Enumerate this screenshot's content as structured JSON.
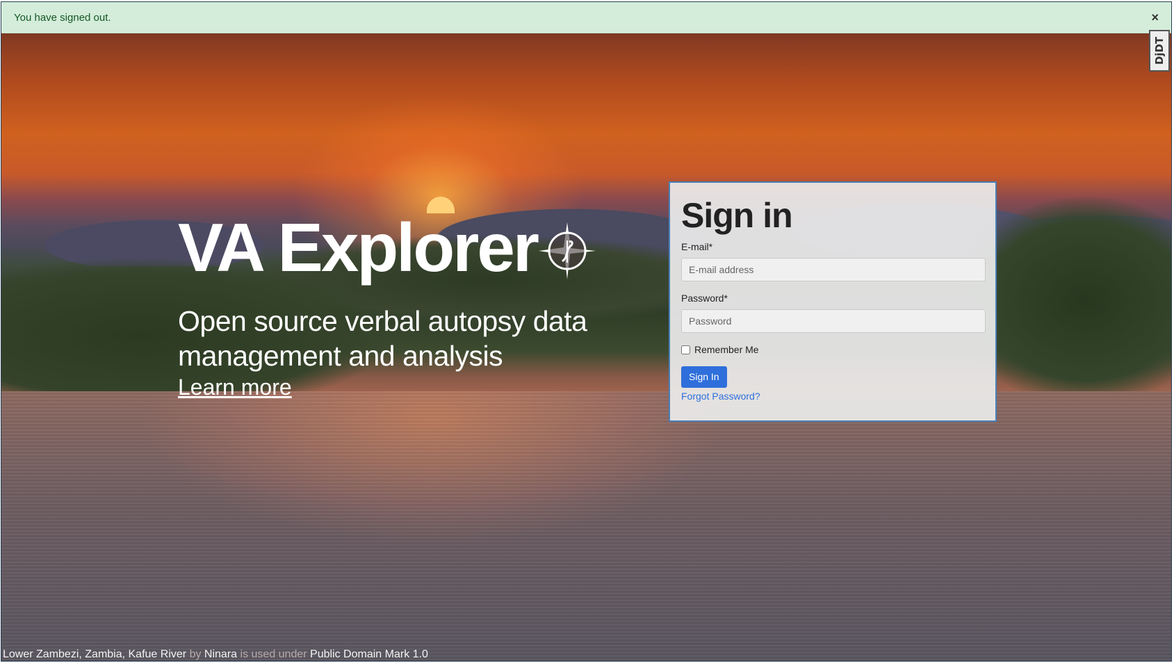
{
  "alert": {
    "message": "You have signed out.",
    "close_label": "×"
  },
  "debug_toolbar": {
    "label": "DjDT"
  },
  "hero": {
    "title": "VA Explorer",
    "subtitle": "Open source verbal autopsy data management and analysis",
    "learn_more": "Learn more"
  },
  "signin": {
    "heading": "Sign in",
    "email_label": "E-mail*",
    "email_placeholder": "E-mail address",
    "password_label": "Password*",
    "password_placeholder": "Password",
    "remember_label": "Remember Me",
    "submit_label": "Sign In",
    "forgot_label": "Forgot Password?"
  },
  "credit": {
    "title": "Lower Zambezi, Zambia, Kafue River",
    "by": "by",
    "author": "Ninara",
    "used_under": "is used under",
    "license": "Public Domain Mark 1.0"
  },
  "colors": {
    "alert_bg": "#d4edda",
    "alert_text": "#155724",
    "primary": "#2f6fdb",
    "card_border": "#4a7fb5"
  }
}
